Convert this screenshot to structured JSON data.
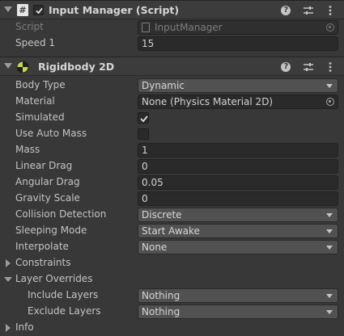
{
  "input_manager": {
    "title": "Input Manager (Script)",
    "enabled": true,
    "script_label": "Script",
    "script_value": "InputManager",
    "speed_label": "Speed 1",
    "speed_value": "15"
  },
  "rigidbody": {
    "title": "Rigidbody 2D",
    "body_type_label": "Body Type",
    "body_type_value": "Dynamic",
    "material_label": "Material",
    "material_value": "None (Physics Material 2D)",
    "simulated_label": "Simulated",
    "simulated": true,
    "use_auto_mass_label": "Use Auto Mass",
    "use_auto_mass": false,
    "mass_label": "Mass",
    "mass_value": "1",
    "linear_drag_label": "Linear Drag",
    "linear_drag_value": "0",
    "angular_drag_label": "Angular Drag",
    "angular_drag_value": "0.05",
    "gravity_scale_label": "Gravity Scale",
    "gravity_scale_value": "0",
    "collision_detection_label": "Collision Detection",
    "collision_detection_value": "Discrete",
    "sleeping_mode_label": "Sleeping Mode",
    "sleeping_mode_value": "Start Awake",
    "interpolate_label": "Interpolate",
    "interpolate_value": "None",
    "constraints_label": "Constraints",
    "layer_overrides_label": "Layer Overrides",
    "include_layers_label": "Include Layers",
    "include_layers_value": "Nothing",
    "exclude_layers_label": "Exclude Layers",
    "exclude_layers_value": "Nothing",
    "info_label": "Info"
  },
  "header_icons": [
    "help-icon",
    "presets-icon",
    "more-icon"
  ],
  "colors": {
    "background": "#383838",
    "header": "#3c3c3c",
    "field": "#2a2a2a",
    "dropdown": "#515151",
    "text": "#c4c4c4"
  }
}
